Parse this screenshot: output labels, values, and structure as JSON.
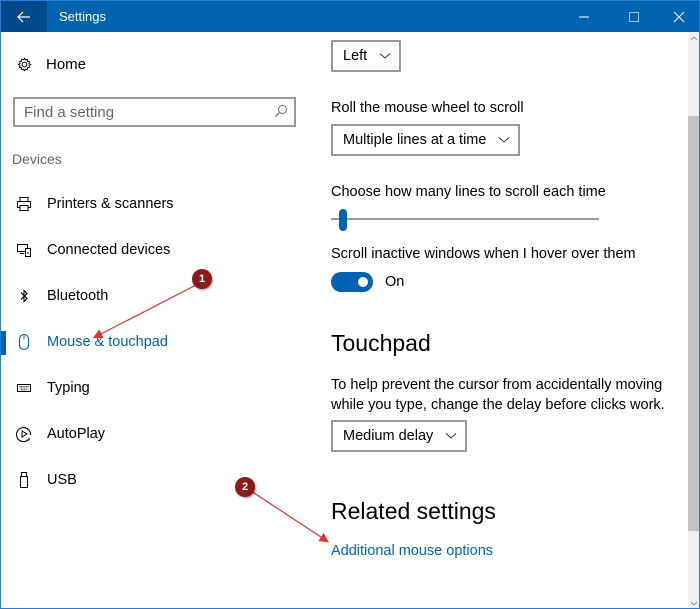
{
  "window": {
    "title": "Settings",
    "accent_color": "#0063b1",
    "titlebar_color": "#0063b1"
  },
  "titlebar": {
    "back_icon": "back-arrow-icon",
    "minimize_icon": "minimize-icon",
    "maximize_icon": "maximize-icon",
    "close_icon": "close-icon"
  },
  "sidebar": {
    "home_label": "Home",
    "home_icon": "gear-icon",
    "search_placeholder": "Find a setting",
    "search_icon": "search-icon",
    "section_label": "Devices",
    "items": [
      {
        "label": "Printers & scanners",
        "icon": "printer-icon",
        "active": false
      },
      {
        "label": "Connected devices",
        "icon": "connected-devices-icon",
        "active": false
      },
      {
        "label": "Bluetooth",
        "icon": "bluetooth-icon",
        "active": false
      },
      {
        "label": "Mouse & touchpad",
        "icon": "mouse-icon",
        "active": true
      },
      {
        "label": "Typing",
        "icon": "keyboard-icon",
        "active": false
      },
      {
        "label": "AutoPlay",
        "icon": "autoplay-icon",
        "active": false
      },
      {
        "label": "USB",
        "icon": "usb-icon",
        "active": false
      }
    ]
  },
  "content": {
    "primary_button_dropdown": {
      "value": "Left"
    },
    "scroll_mode": {
      "label": "Roll the mouse wheel to scroll",
      "value": "Multiple lines at a time"
    },
    "lines_slider": {
      "label": "Choose how many lines to scroll each time",
      "value_fraction": 0.03
    },
    "inactive_scroll": {
      "label": "Scroll inactive windows when I hover over them",
      "state": "On",
      "enabled": true
    },
    "touchpad": {
      "heading": "Touchpad",
      "description_line1": "To help prevent the cursor from accidentally moving",
      "description_line2": "while you type, change the delay before clicks work.",
      "delay_value": "Medium delay"
    },
    "related": {
      "heading": "Related settings",
      "link": "Additional mouse options"
    }
  },
  "scrollbar": {
    "position_fraction": 0.13,
    "visible_fraction": 0.75
  },
  "annotations": [
    {
      "number": "1",
      "target": "Mouse & touchpad"
    },
    {
      "number": "2",
      "target": "Additional mouse options"
    }
  ]
}
